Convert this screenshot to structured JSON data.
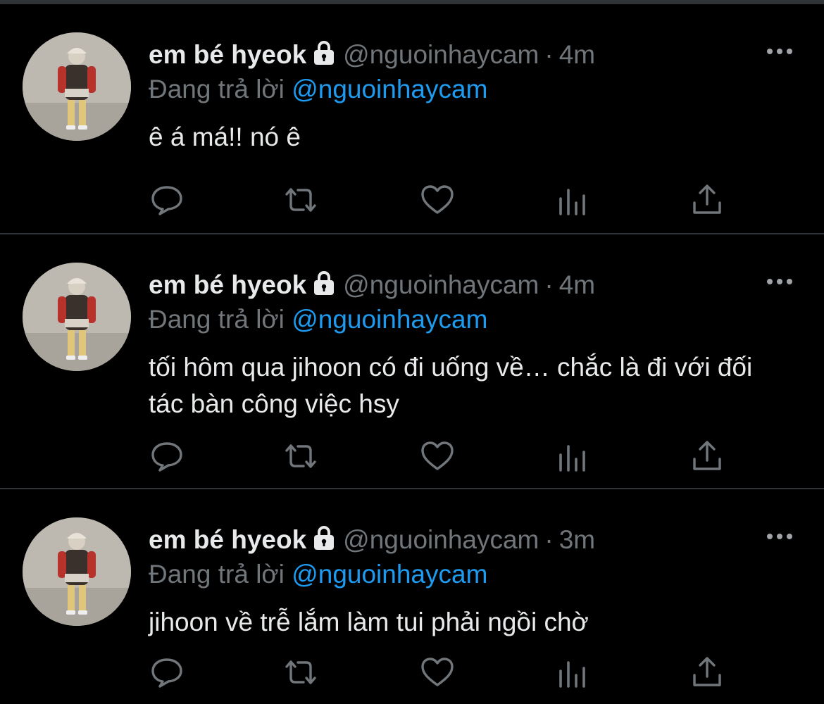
{
  "tweets": [
    {
      "display_name": "em bé hyeok",
      "handle": "@nguoinhaycam",
      "separator": "·",
      "time": "4m",
      "reply_prefix": "Đang trả lời",
      "reply_to": "@nguoinhaycam",
      "text": "ê á má!! nó ê"
    },
    {
      "display_name": "em bé hyeok",
      "handle": "@nguoinhaycam",
      "separator": "·",
      "time": "4m",
      "reply_prefix": "Đang trả lời",
      "reply_to": "@nguoinhaycam",
      "text": "tối hôm qua jihoon có đi uống về… chắc là đi với đối tác bàn công việc hsy"
    },
    {
      "display_name": "em bé hyeok",
      "handle": "@nguoinhaycam",
      "separator": "·",
      "time": "3m",
      "reply_prefix": "Đang trả lời",
      "reply_to": "@nguoinhaycam",
      "text": "jihoon về trễ lắm làm tui phải ngồi chờ"
    }
  ],
  "icons": {
    "lock": "lock-icon",
    "more": "more-icon",
    "reply": "reply-icon",
    "retweet": "retweet-icon",
    "like": "heart-icon",
    "stats": "stats-icon",
    "share": "share-icon"
  },
  "colors": {
    "background": "#000000",
    "text": "#e7e9ea",
    "secondary": "#71767b",
    "accent": "#1d9bf0",
    "divider": "#2f3336"
  }
}
